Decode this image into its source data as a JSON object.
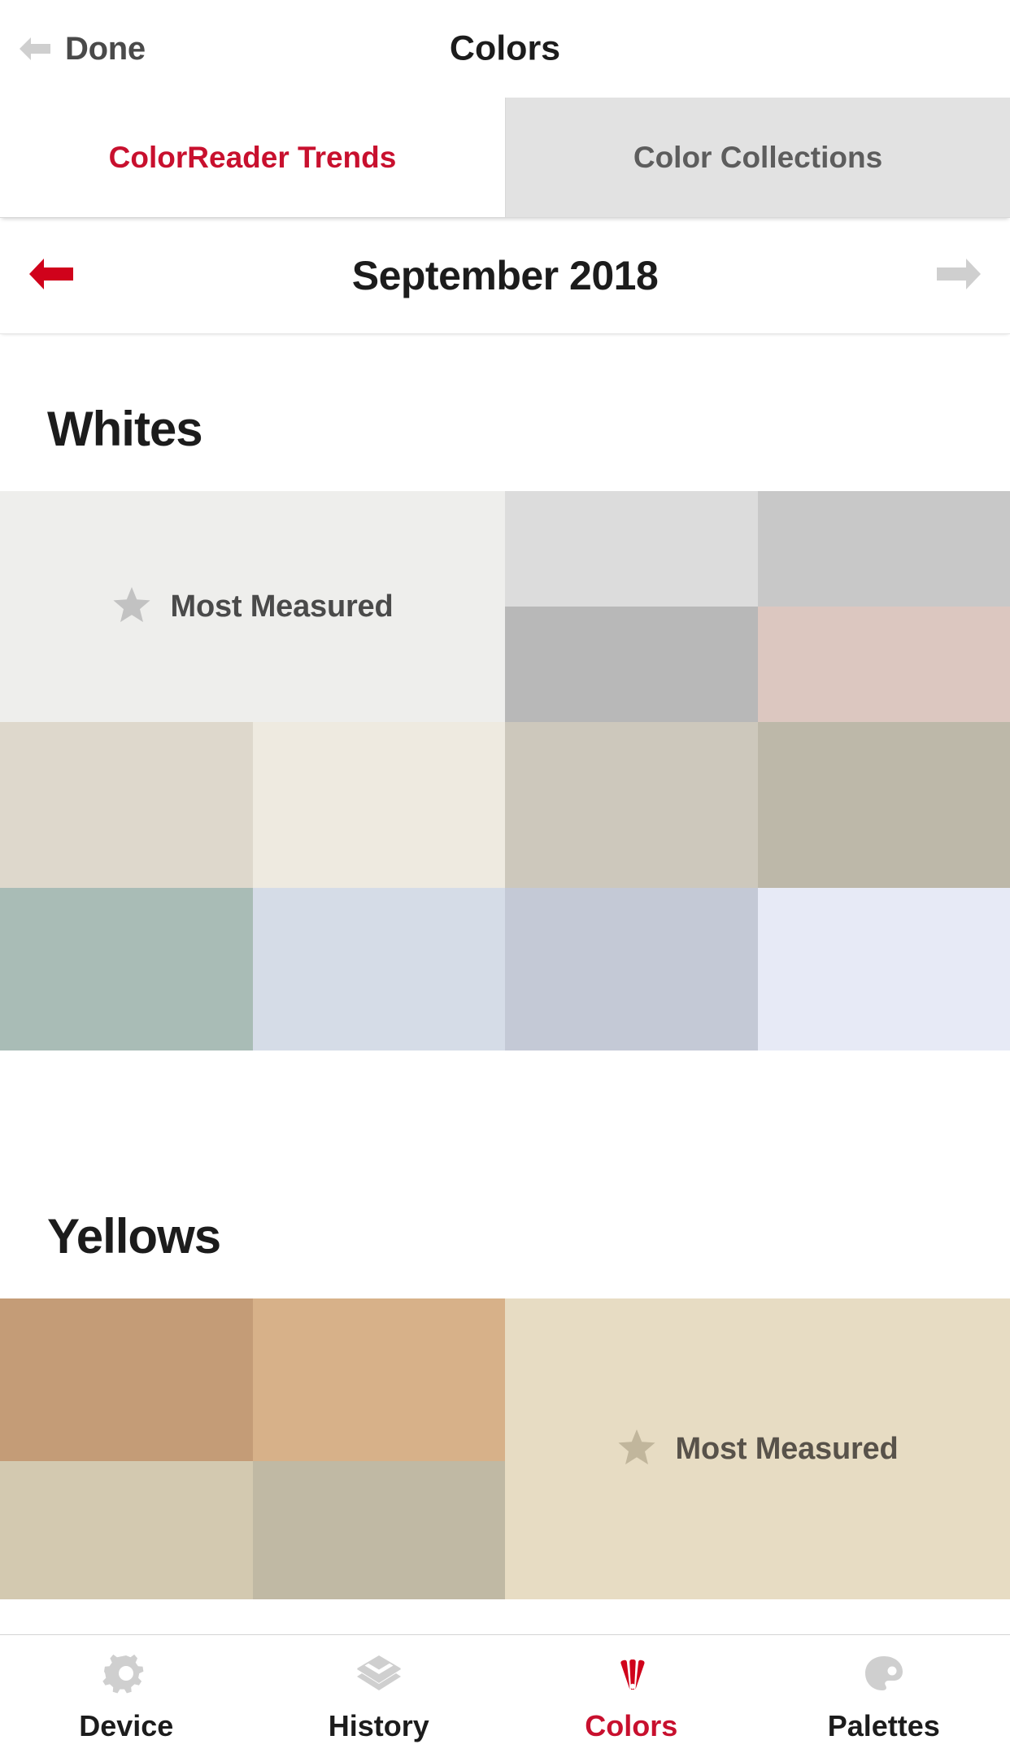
{
  "header": {
    "back_icon": "arrow-left-icon",
    "done_label": "Done",
    "title": "Colors"
  },
  "tabs": [
    {
      "label": "ColorReader Trends",
      "active": true
    },
    {
      "label": "Color Collections",
      "active": false
    }
  ],
  "month_nav": {
    "prev_icon": "arrow-left-icon",
    "next_icon": "arrow-right-icon",
    "label": "September 2018",
    "prev_color": "#d0021b",
    "next_color": "#cfcfcf"
  },
  "sections": [
    {
      "title": "Whites",
      "most_measured": {
        "label": "Most Measured",
        "star_icon": "star-icon",
        "color": "#eeeeec",
        "star_color": "#c2c2c2"
      },
      "swatches": [
        "#dcdcdc",
        "#c8c8c8",
        "#b8b8b8",
        "#dcc7c0",
        "#ded8cc",
        "#eeeae0",
        "#cdc8bc",
        "#bdb8a9",
        "#a9bcb6",
        "#d5dce7",
        "#c4c9d6",
        "#e7eaf6"
      ]
    },
    {
      "title": "Yellows",
      "most_measured": {
        "label": "Most Measured",
        "star_icon": "star-icon",
        "color": "#e7dcc3",
        "star_color": "#c1b69c"
      },
      "swatches": [
        "#c49c77",
        "#d7b189",
        "#d3c9b0",
        "#c0b9a4"
      ]
    }
  ],
  "bottom_tabs": [
    {
      "label": "Device",
      "icon": "gear-icon",
      "active": false
    },
    {
      "label": "History",
      "icon": "layers-icon",
      "active": false
    },
    {
      "label": "Colors",
      "icon": "fandeck-icon",
      "active": true
    },
    {
      "label": "Palettes",
      "icon": "palette-icon",
      "active": false
    }
  ],
  "colors": {
    "accent_red": "#c8102e",
    "nav_red": "#d0021b",
    "inactive_gray": "#cfcfcf"
  }
}
